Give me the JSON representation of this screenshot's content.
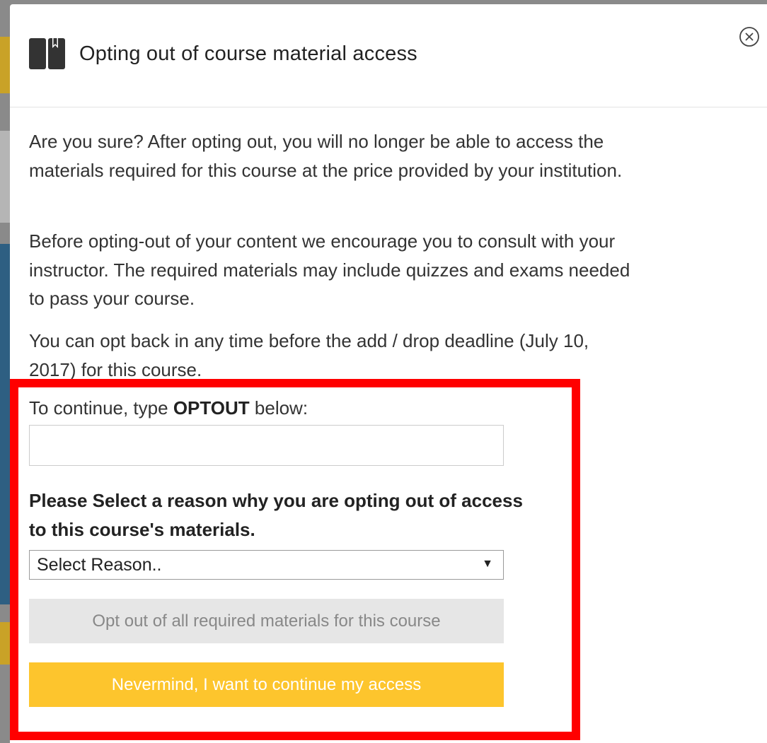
{
  "modal": {
    "title": "Opting out of course material access",
    "header_icon": "book-bookmark-icon",
    "close_icon": "close-circle-icon",
    "paragraphs": [
      "Are you sure? After opting out, you will no longer be able to access the materials required for this course at the price provided by your institution.",
      "Before opting-out of your content we encourage you to consult with your instructor. The required materials may include quizzes and exams needed to pass your course.",
      "You can opt back in any time before the add / drop deadline (July 10, 2017) for this course."
    ]
  },
  "form": {
    "confirm_prefix": "To continue, type ",
    "confirm_keyword": "OPTOUT",
    "confirm_suffix": " below:",
    "confirm_value": "",
    "reason_heading": "Please Select a reason why you are opting out of access to this course's materials.",
    "reason_selected": "Select Reason..",
    "optout_button": "Opt out of all required materials for this course",
    "nevermind_button": "Nevermind, I want to continue my access"
  },
  "colors": {
    "highlight_border": "#ff0000",
    "primary_button": "#fdc52d",
    "disabled_button": "#e6e6e6"
  }
}
